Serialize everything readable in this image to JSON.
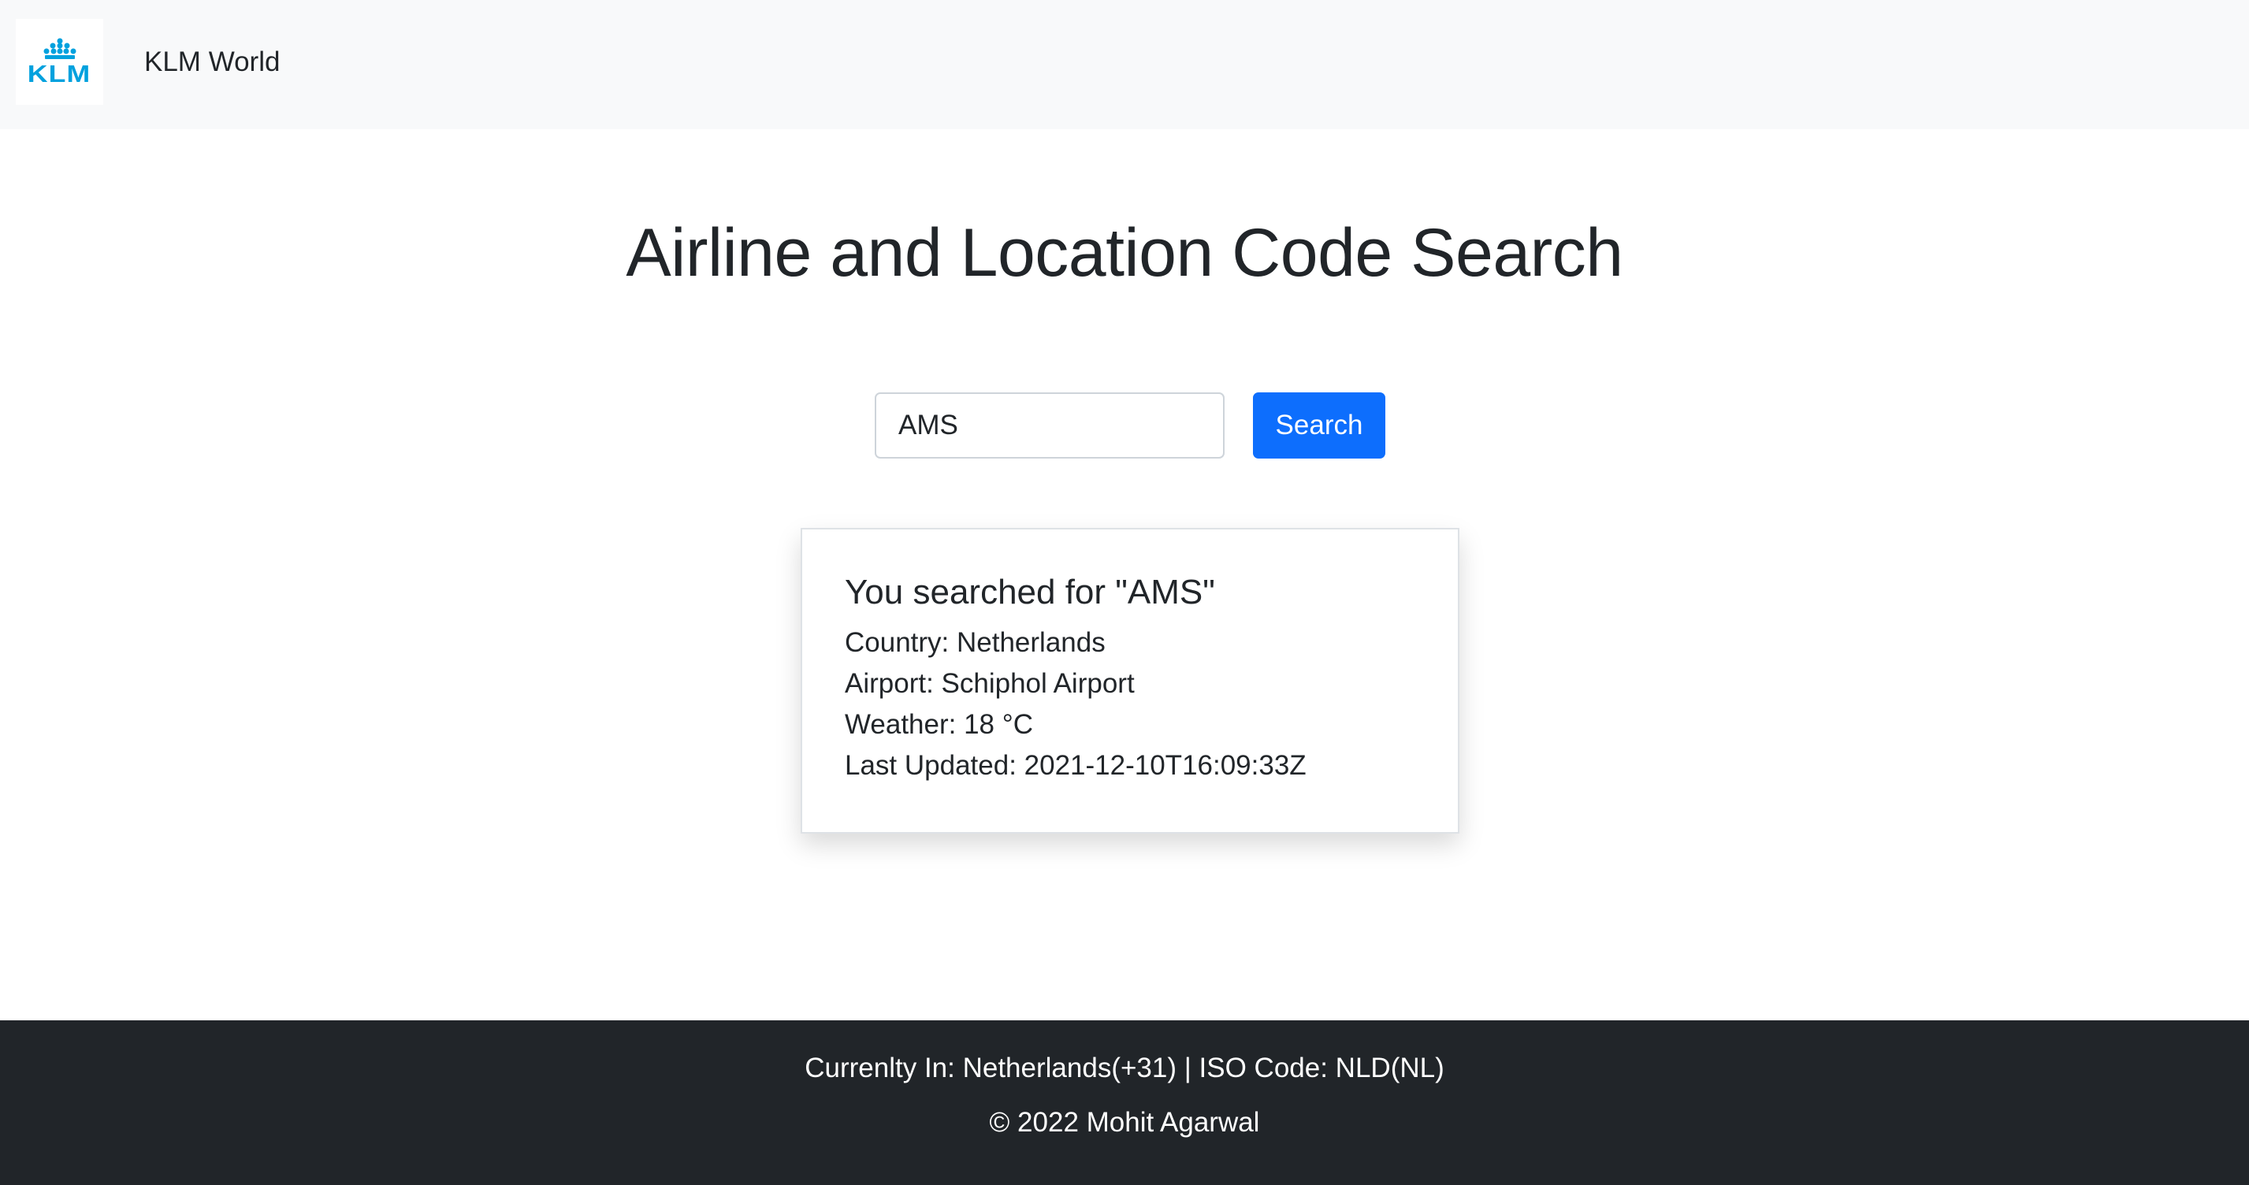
{
  "navbar": {
    "logo_text": "KLM",
    "logo_icon": "crown-icon",
    "brand": "KLM World"
  },
  "main": {
    "title": "Airline and Location Code Search",
    "search": {
      "value": "AMS",
      "placeholder": "",
      "button_label": "Search"
    },
    "result": {
      "heading": "You searched for \"AMS\"",
      "country": "Country: Netherlands",
      "airport": "Airport: Schiphol Airport",
      "weather": "Weather: 18 °C",
      "last_updated": "Last Updated: 2021-12-10T16:09:33Z"
    }
  },
  "footer": {
    "location": "Currenlty In: Netherlands(+31) | ISO Code: NLD(NL)",
    "copyright": "© 2022 Mohit Agarwal"
  },
  "colors": {
    "navbar_bg": "#f8f9fa",
    "brand_blue": "#00a1de",
    "button_primary": "#0d6efd",
    "footer_bg": "#212529",
    "text": "#212529"
  }
}
